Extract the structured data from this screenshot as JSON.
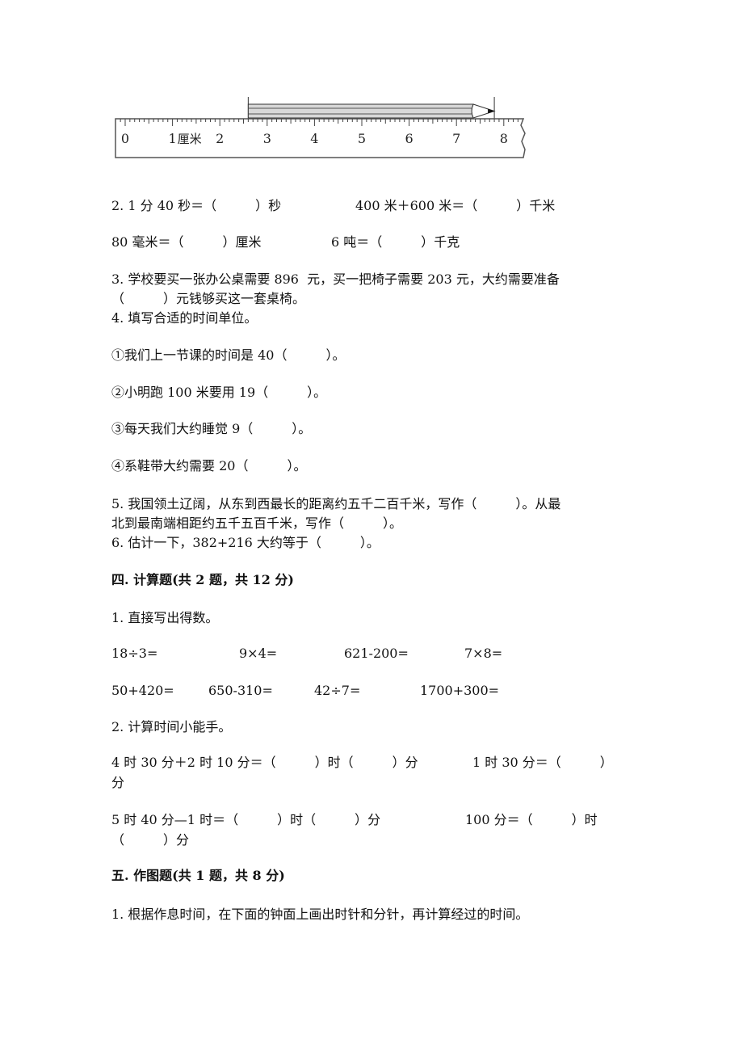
{
  "ruler_figure": {
    "unit_label": "厘米",
    "tick_labels": [
      "0",
      "1",
      "2",
      "3",
      "4",
      "5",
      "6",
      "7",
      "8"
    ],
    "range_cm": [
      0,
      8
    ],
    "pencil_start_cm": 2.6,
    "pencil_end_cm": 7.8
  },
  "q2": {
    "line1_a": "2. 1 分 40 秒＝（　　　）秒",
    "line1_b": "400 米＋600 米＝（　　　）千米",
    "line2_a": "80 毫米＝（　　　）厘米",
    "line2_b": "6 吨＝（　　　）千克"
  },
  "q3": {
    "line1": "3. 学校要买一张办公桌需要 896  元，买一把椅子需要 203 元，大约需要准备",
    "line2": "（　　　）元钱够买这一套桌椅。"
  },
  "q4": {
    "title": "4. 填写合适的时间单位。",
    "items": [
      "①我们上一节课的时间是 40（　　　）。",
      "②小明跑 100 米要用 19（　　　）。",
      "③每天我们大约睡觉 9（　　　）。",
      "④系鞋带大约需要 20（　　　）。"
    ]
  },
  "q5": {
    "line1": "5. 我国领土辽阔，从东到西最长的距离约五千二百千米，写作（　　　）。从最",
    "line2": "北到最南端相距约五千五百千米，写作（　　　）。"
  },
  "q6": {
    "line1": "6. 估计一下，382+216 大约等于（　　　）。"
  },
  "section4": {
    "heading": "四. 计算题(共 2 题，共 12 分)",
    "q1_title": "1. 直接写出得数。",
    "row1": [
      "18÷3=",
      "9×4=",
      "621-200=",
      "7×8="
    ],
    "row2": [
      "50+420=",
      "650-310=",
      "42÷7=",
      "1700+300="
    ],
    "q2_title": "2. 计算时间小能手。",
    "time_line1_a": "4 时 30 分＋2 时 10 分＝（　　　）时（　　　）分",
    "time_line1_b": "1 时 30 分＝（　　　）",
    "time_line1_wrap": "分",
    "time_line2_a": "5 时 40 分—1 时＝（　　　）时（　　　）分",
    "time_line2_b": "100 分＝（　　　）时",
    "time_line2_wrap": "（　　　）分"
  },
  "section5": {
    "heading": "五. 作图题(共 1 题，共 8 分)",
    "q1": "1. 根据作息时间，在下面的钟面上画出时针和分针，再计算经过的时间。"
  }
}
